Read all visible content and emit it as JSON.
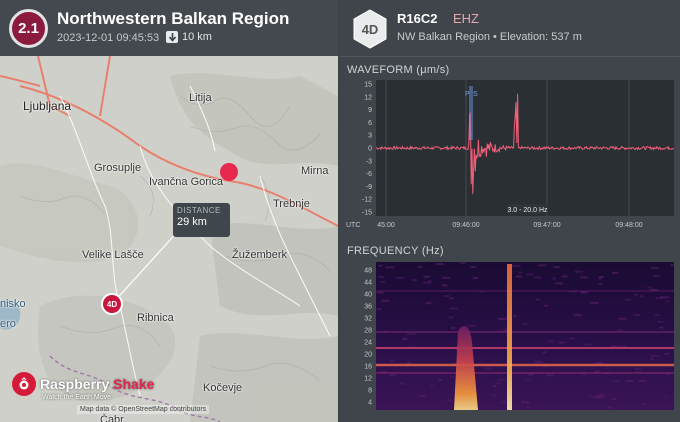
{
  "event": {
    "magnitude": "2.1",
    "title": "Northwestern Balkan Region",
    "datetime": "2023-12-01 09:45:53",
    "depth": "10 km",
    "depth_icon": "arrow-down-icon"
  },
  "map": {
    "labels": {
      "ljubljana": "Ljubljana",
      "litija": "Litija",
      "grosuplje": "Grosuplje",
      "ivancna_gorica": "Ivančna Gorica",
      "mirna": "Mirna",
      "trebnje": "Trebnje",
      "velike_lasce": "Velike Lašče",
      "zuzemberk": "Žužemberk",
      "ribnica": "Ribnica",
      "kocevje": "Kočevje",
      "nisko_partial": "nisko",
      "jezero_partial": "ero",
      "cabar_partial": "Čabr"
    },
    "distance_label": "DISTANCE",
    "distance_value": "29 km",
    "station_marker": "4D",
    "attribution": "Map data © OpenStreetMap contributors",
    "colors": {
      "epicenter": "#e8294f",
      "road": "#e8806e"
    }
  },
  "branding": {
    "name_part1": "Raspberry",
    "name_part2": "Shake",
    "tagline": "Watch the Earth Move"
  },
  "station": {
    "network": "4D",
    "name": "R16C2",
    "separator": "•",
    "channel": "EHZ",
    "region": "NW Balkan Region",
    "elevation": "Elevation: 537 m"
  },
  "waveform": {
    "title": "WAVEFORM (μm/s)",
    "y_ticks": [
      "15",
      "12",
      "9",
      "6",
      "3",
      "0",
      "-3",
      "-6",
      "-9",
      "-12",
      "-15"
    ],
    "x_ticks": [
      "UTC",
      "45:00",
      "09:46:00",
      "09:47:00",
      "09:48:00"
    ],
    "p_label": "P",
    "s_label": "S",
    "filter": "3.0 - 20.0 Hz",
    "color": "#f0607a"
  },
  "frequency": {
    "title": "FREQUENCY (Hz)",
    "y_ticks": [
      "48",
      "44",
      "40",
      "36",
      "32",
      "28",
      "24",
      "20",
      "16",
      "12",
      "8",
      "4"
    ]
  },
  "chart_data": [
    {
      "type": "line",
      "title": "WAVEFORM (μm/s)",
      "x": [
        "45:00",
        "09:46:00",
        "09:47:00",
        "09:48:00"
      ],
      "ylim": [
        -16,
        16
      ],
      "series": [
        {
          "values": [
            0,
            15,
            0,
            0
          ]
        }
      ],
      "annotations": [
        "P",
        "S",
        "3.0 - 20.0 Hz"
      ]
    },
    {
      "type": "heatmap",
      "title": "FREQUENCY (Hz)",
      "ylim": [
        0,
        50
      ]
    }
  ]
}
